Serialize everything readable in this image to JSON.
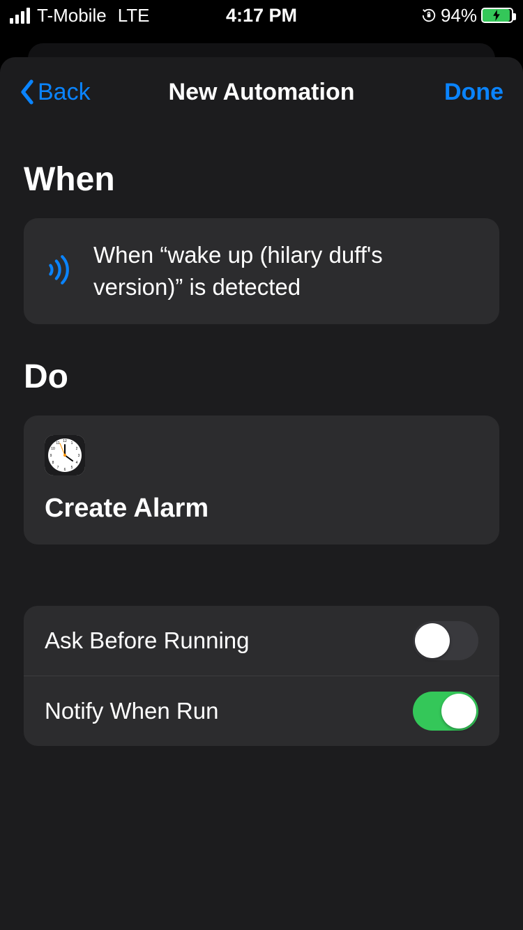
{
  "status": {
    "carrier": "T-Mobile",
    "network": "LTE",
    "time": "4:17 PM",
    "battery_pct": "94%"
  },
  "nav": {
    "back_label": "Back",
    "title": "New Automation",
    "done_label": "Done"
  },
  "sections": {
    "when_heading": "When",
    "when_text": "When “wake up (hilary duff's version)” is detected",
    "do_heading": "Do",
    "action_label": "Create Alarm"
  },
  "settings": {
    "ask_label": "Ask Before Running",
    "ask_on": false,
    "notify_label": "Notify When Run",
    "notify_on": true
  }
}
